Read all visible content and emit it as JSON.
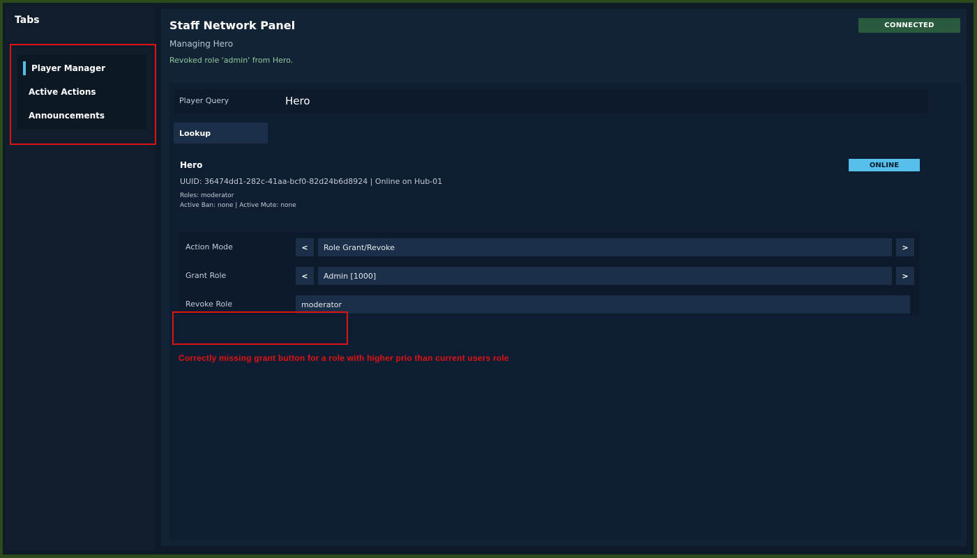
{
  "sidebar": {
    "title": "Tabs",
    "tabs": [
      {
        "label": "Player Manager",
        "active": true
      },
      {
        "label": "Active Actions",
        "active": false
      },
      {
        "label": "Announcements",
        "active": false
      }
    ]
  },
  "header": {
    "title": "Staff Network Panel",
    "subtitle": "Managing Hero",
    "status_message": "Revoked role 'admin' from Hero.",
    "connection_status": "CONNECTED"
  },
  "query": {
    "label": "Player Query",
    "value": "Hero",
    "lookup_label": "Lookup"
  },
  "player": {
    "name": "Hero",
    "status": "ONLINE",
    "uuid_line": "UUID: 36474dd1-282c-41aa-bcf0-82d24b6d8924 | Online on Hub-01",
    "roles_line": "Roles: moderator",
    "ban_line": "Active Ban: none | Active Mute: none"
  },
  "actions": {
    "action_mode": {
      "label": "Action Mode",
      "value": "Role Grant/Revoke",
      "prev": "<",
      "next": ">"
    },
    "grant_role": {
      "label": "Grant Role",
      "value": "Admin [1000]",
      "prev": "<",
      "next": ">"
    },
    "revoke_role": {
      "label": "Revoke Role",
      "value": "moderator"
    }
  },
  "annotation": {
    "text": "Correctly missing grant button for a role with higher prio than current users role"
  },
  "colors": {
    "accent": "#56c0ea",
    "connected": "#2a5a3d",
    "annotation_red": "#e01212",
    "status_message": "#8fc99b"
  }
}
